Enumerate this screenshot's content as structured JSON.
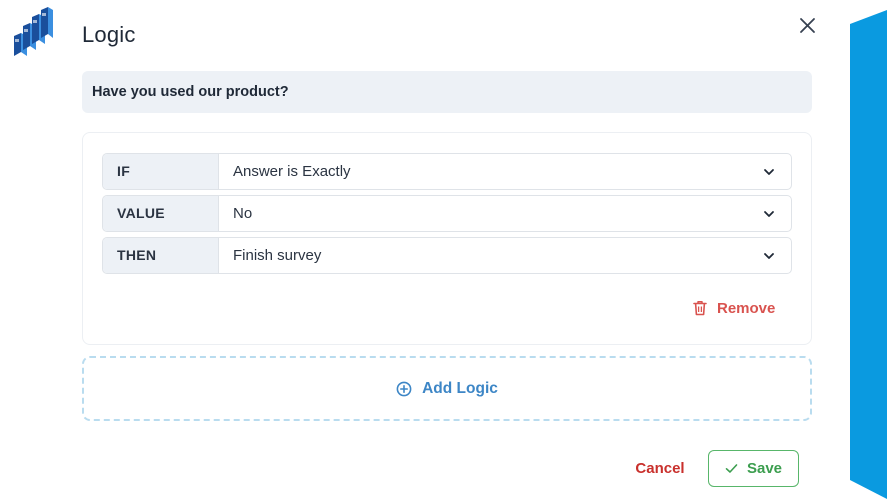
{
  "dialog": {
    "title": "Logic",
    "question": "Have you used our product?"
  },
  "rules": [
    {
      "label": "IF",
      "value": "Answer is Exactly"
    },
    {
      "label": "VALUE",
      "value": "No"
    },
    {
      "label": "THEN",
      "value": "Finish survey"
    }
  ],
  "actions": {
    "remove_label": "Remove",
    "add_logic_label": "Add Logic",
    "cancel_label": "Cancel",
    "save_label": "Save"
  },
  "icons": {
    "logo": "bar-stairs-logo-icon",
    "close": "close-icon",
    "chevron": "chevron-down-icon",
    "remove": "trash-icon",
    "add": "plus-circle-icon",
    "save": "check-icon"
  },
  "colors": {
    "brand_blue": "#0a9ae0",
    "question_bg": "#edf1f6",
    "danger": "#d9534f",
    "link_blue": "#3d86c6",
    "dashed_border": "#b9dcef",
    "success": "#3c9e4f"
  }
}
